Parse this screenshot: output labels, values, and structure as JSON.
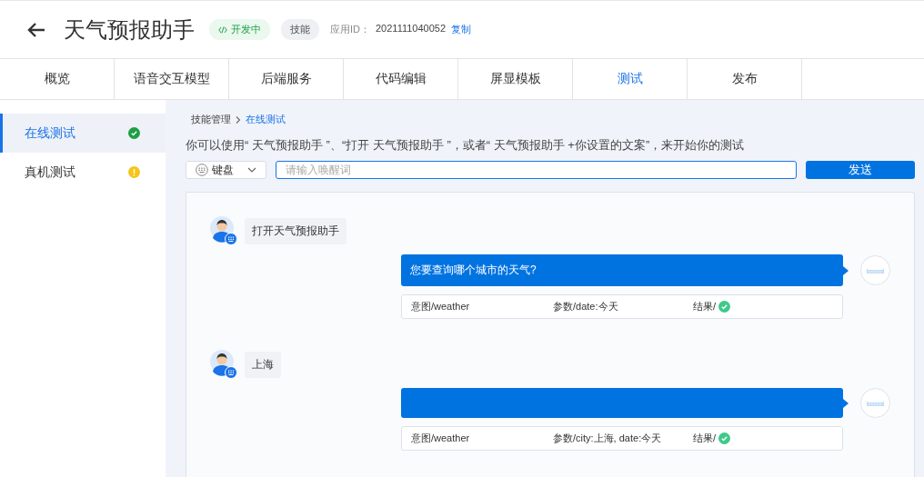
{
  "header": {
    "title": "天气预报助手",
    "status_badge": "开发中",
    "type_badge": "技能",
    "app_id_label": "应用ID：",
    "app_id": "2021111040052",
    "copy_link": "复制"
  },
  "tabs": [
    {
      "label": "概览",
      "selected": false
    },
    {
      "label": "语音交互模型",
      "selected": false
    },
    {
      "label": "后端服务",
      "selected": false
    },
    {
      "label": "代码编辑",
      "selected": false
    },
    {
      "label": "屏显模板",
      "selected": false
    },
    {
      "label": "测试",
      "selected": true
    },
    {
      "label": "发布",
      "selected": false
    }
  ],
  "sidebar": {
    "items": [
      {
        "label": "在线测试",
        "selected": true,
        "kind": "passed"
      },
      {
        "label": "真机测试",
        "selected": false,
        "kind": "warning"
      }
    ]
  },
  "breadcrumb": [
    {
      "label": "技能管理",
      "selected": false
    },
    {
      "label": "在线测试",
      "selected": true
    }
  ],
  "instruction": "你可以使用“ 天气预报助手 ”、“打开 天气预报助手 ”，或者“ 天气预报助手 +你设置的文案”，来开始你的测试",
  "input_mode": {
    "label": "键盘"
  },
  "wake_input": {
    "placeholder": "请输入唤醒词"
  },
  "send_button": "发送",
  "chat": [
    {
      "kind": "user",
      "text": "打开天气预报助手"
    },
    {
      "kind": "bot",
      "text": "您要查询哪个城市的天气?",
      "intent": "意图/weather",
      "params": "参数/date:今天",
      "result_label": "结果/",
      "result_ok": true
    },
    {
      "kind": "user",
      "text": "上海"
    },
    {
      "kind": "bot",
      "intent": "意图/weather",
      "params": "参数/city:上海, date:今天",
      "result_label": "结果/",
      "result_ok": true
    }
  ]
}
